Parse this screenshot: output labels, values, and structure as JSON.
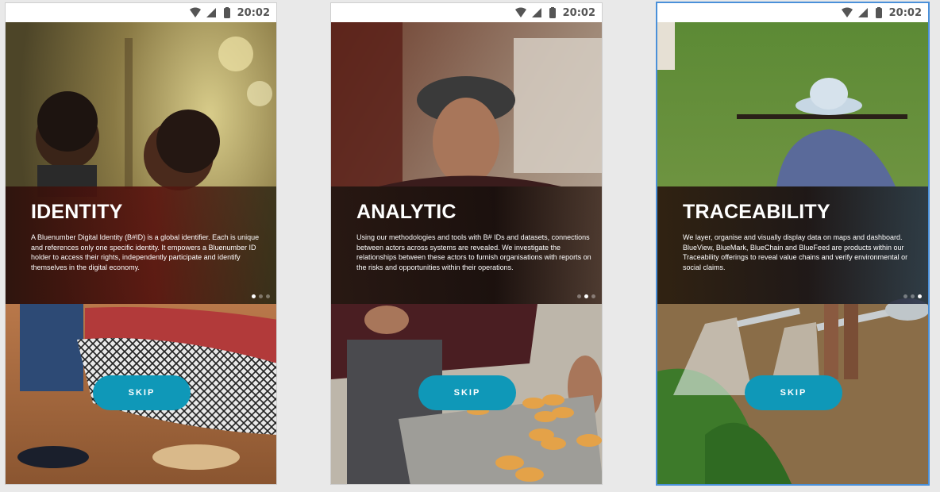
{
  "status_bar": {
    "time": "20:02"
  },
  "slides": [
    {
      "title": "IDENTITY",
      "description": "A Bluenumber Digital Identity (B#ID) is a global identifier. Each is unique and references only one specific identity. It empowers a Bluenumber ID holder to access their rights, independently participate and identify themselves in the digital economy.",
      "active_dot": 1,
      "skip_label": "SKIP"
    },
    {
      "title": "ANALYTIC",
      "description": "Using our methodologies and tools with B# IDs and datasets, connections between actors across systems are revealed. We investigate the relationships between these actors to furnish organisations with reports on the risks and opportunities within their operations.",
      "active_dot": 2,
      "skip_label": "SKIP"
    },
    {
      "title": "TRACEABILITY",
      "description": "We layer, organise and visually display data on maps and dashboard. BlueView, BlueMark, BlueChain and BlueFeed are products within our Traceability offerings to reveal value chains and verify environmental or social claims.",
      "active_dot": 3,
      "skip_label": "SKIP"
    }
  ],
  "colors": {
    "skip_button": "#0f98b8",
    "selection_border": "#4a90d9"
  },
  "icons": [
    "wifi-icon",
    "signal-icon",
    "battery-icon"
  ]
}
